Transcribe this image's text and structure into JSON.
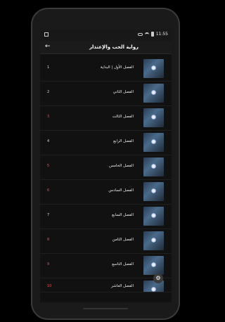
{
  "status": {
    "time": "11:55"
  },
  "appbar": {
    "title": "رواية الحب والإعتذار"
  },
  "chapters": [
    {
      "num": "1",
      "label": "الفصل الأول | البداية"
    },
    {
      "num": "2",
      "label": "الفصل الثاني"
    },
    {
      "num": "3",
      "label": "الفصل الثالث"
    },
    {
      "num": "4",
      "label": "الفصل الرابع"
    },
    {
      "num": "5",
      "label": "الفصل الخامس"
    },
    {
      "num": "6",
      "label": "الفصل السادس"
    },
    {
      "num": "7",
      "label": "الفصل السابع"
    },
    {
      "num": "8",
      "label": "الفصل الثامن"
    },
    {
      "num": "9",
      "label": "الفصل التاسع"
    },
    {
      "num": "10",
      "label": "الفصل العاشر"
    }
  ],
  "fab_icon": "gear-icon",
  "colors": {
    "accent_number": "#e05555"
  }
}
